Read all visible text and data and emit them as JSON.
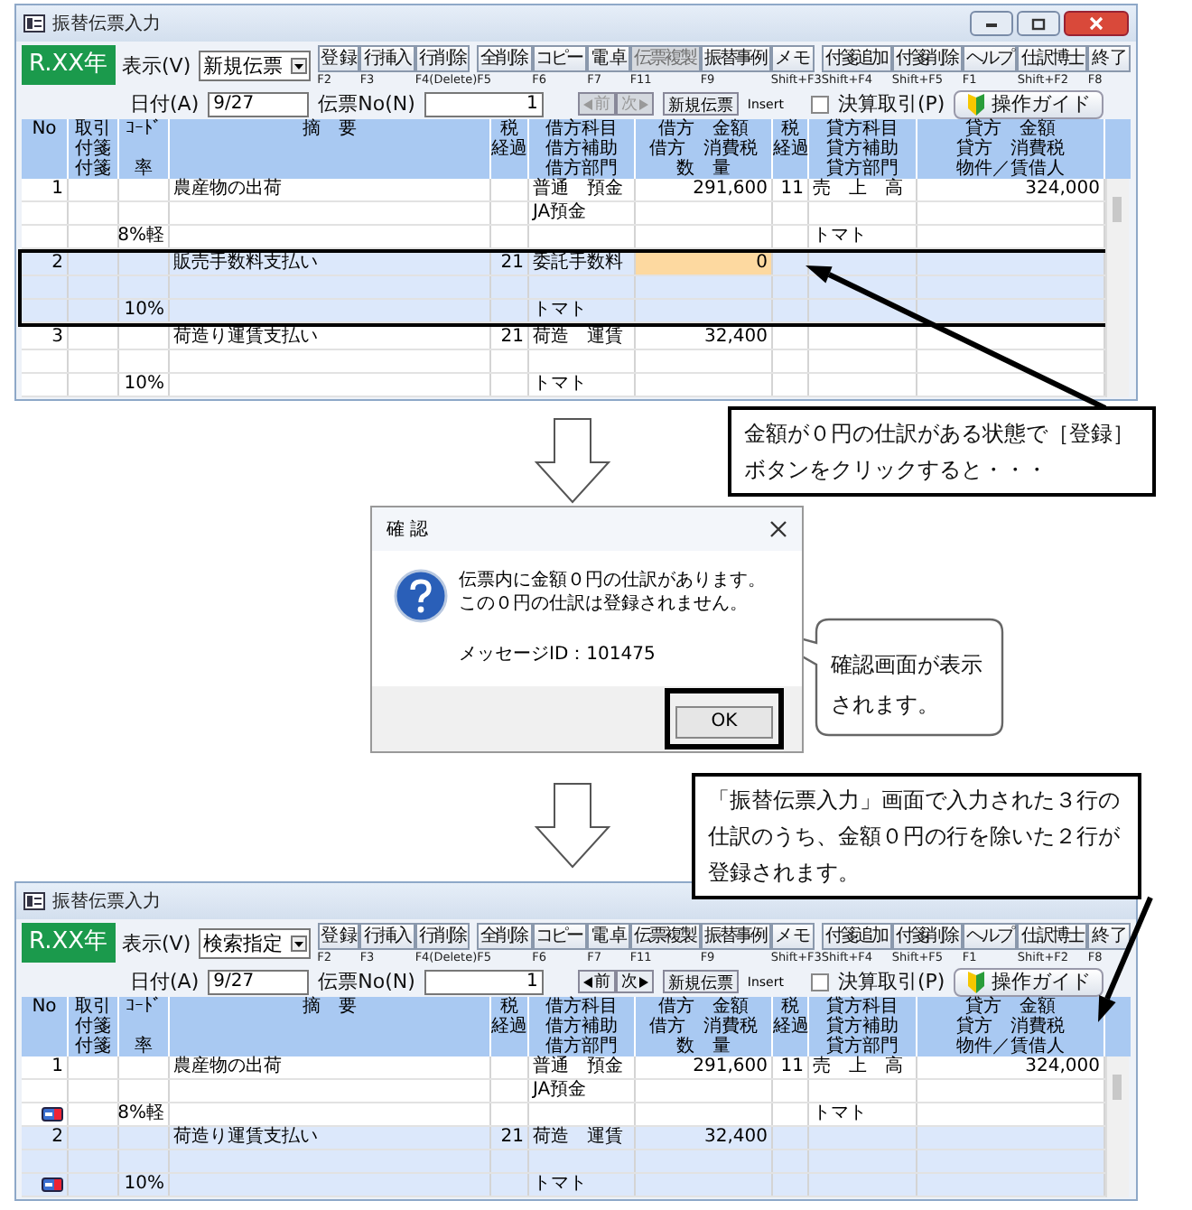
{
  "windows": [
    {
      "title": "振替伝票入力",
      "window_buttons": true,
      "year": "R.XX年",
      "view_label": "表示(V)",
      "view_value": "新規伝票",
      "toolbar": [
        {
          "label": "登 録",
          "key": "F2",
          "disabled": false
        },
        {
          "label": "行挿入",
          "key": "F3",
          "disabled": false
        },
        {
          "label": "行削除",
          "key": "F4(Delete)",
          "disabled": false
        },
        {
          "label": "全削除",
          "key": "F5",
          "disabled": false
        },
        {
          "label": "コピー",
          "key": "F6",
          "disabled": false
        },
        {
          "label": "電 卓",
          "key": "F7",
          "disabled": false
        },
        {
          "label": "伝票複製",
          "key": "F11",
          "disabled": true
        },
        {
          "label": "振替事例",
          "key": "F9",
          "disabled": false
        },
        {
          "label": "メ モ",
          "key": "Shift+F3",
          "disabled": false
        },
        {
          "label": "付箋追加",
          "key": "Shift+F4",
          "disabled": false
        },
        {
          "label": "付箋削除",
          "key": "Shift+F5",
          "disabled": false
        },
        {
          "label": "ヘルプ",
          "key": "F1",
          "disabled": false
        },
        {
          "label": "仕訳博士",
          "key": "Shift+F2",
          "disabled": false
        },
        {
          "label": "終 了",
          "key": "F8",
          "disabled": false
        }
      ],
      "date_label": "日付(A)",
      "date": "9/27",
      "slip_label": "伝票No(N)",
      "slip_no": "1",
      "prev": "前",
      "next": "次",
      "nav_disabled": true,
      "new_slip": "新規伝票",
      "new_slip_key": "Insert",
      "closing": {
        "label": "決算取引(P)",
        "checked": false
      },
      "guide": "操作ガイド",
      "header": [
        {
          "line_1": "No"
        },
        {
          "line_1": "取引",
          "line_2": "付箋",
          "line_3": "付箋"
        },
        {
          "line_1": "ｺｰﾄﾞ",
          "line_3": "率"
        },
        {
          "line_1": "摘　要"
        },
        {
          "line_1": "税",
          "line_2": "経過"
        },
        {
          "line_1": "借方科目",
          "line_2": "借方補助",
          "line_3": "借方部門"
        },
        {
          "line_1": "借方　金額",
          "line_2": "借方　消費税",
          "line_3": "数　量"
        },
        {
          "line_1": "税",
          "line_2": "経過"
        },
        {
          "line_1": "貸方科目",
          "line_2": "貸方補助",
          "line_3": "貸方部門"
        },
        {
          "line_1": "貸方　金額",
          "line_2": "貸方　消費税",
          "line_3": "物件／賃借人"
        }
      ],
      "entries": [
        {
          "selected": false,
          "outlined": false,
          "tag_icon": false,
          "amount_focused": false,
          "line_1": {
            "no": "1",
            "summary": "農産物の出荷",
            "account": "普通　預金",
            "amount": "291,600",
            "credit_tax": "11",
            "credit_account": "売　上　高",
            "credit_amount": "324,000"
          },
          "line_2": {
            "account": "JA預金"
          },
          "line_3": {
            "code": "8%軽",
            "credit_account": "トマト"
          }
        },
        {
          "selected": true,
          "outlined": true,
          "tag_icon": false,
          "amount_focused": true,
          "line_1": {
            "no": "2",
            "summary": "販売手数料支払い",
            "tax": "21",
            "account": "委託手数料",
            "amount": "0"
          },
          "line_3": {
            "code": "10%",
            "account": "トマト"
          }
        },
        {
          "selected": false,
          "outlined": false,
          "tag_icon": false,
          "amount_focused": false,
          "line_1": {
            "no": "3",
            "summary": "荷造り運賃支払い",
            "tax": "21",
            "account": "荷造　運賃",
            "amount": "32,400"
          },
          "line_3": {
            "code": "10%",
            "account": "トマト"
          }
        }
      ]
    },
    {
      "title": "振替伝票入力",
      "window_buttons": false,
      "year": "R.XX年",
      "view_label": "表示(V)",
      "view_value": "検索指定",
      "toolbar": [
        {
          "label": "登 録",
          "key": "F2",
          "disabled": false
        },
        {
          "label": "行挿入",
          "key": "F3",
          "disabled": false
        },
        {
          "label": "行削除",
          "key": "F4(Delete)",
          "disabled": false
        },
        {
          "label": "全削除",
          "key": "F5",
          "disabled": false
        },
        {
          "label": "コピー",
          "key": "F6",
          "disabled": false
        },
        {
          "label": "電 卓",
          "key": "F7",
          "disabled": false
        },
        {
          "label": "伝票複製",
          "key": "F11",
          "disabled": false
        },
        {
          "label": "振替事例",
          "key": "F9",
          "disabled": false
        },
        {
          "label": "メ モ",
          "key": "Shift+F3",
          "disabled": false
        },
        {
          "label": "付箋追加",
          "key": "Shift+F4",
          "disabled": false
        },
        {
          "label": "付箋削除",
          "key": "Shift+F5",
          "disabled": false
        },
        {
          "label": "ヘルプ",
          "key": "F1",
          "disabled": false
        },
        {
          "label": "仕訳博士",
          "key": "Shift+F2",
          "disabled": false
        },
        {
          "label": "終 了",
          "key": "F8",
          "disabled": false
        }
      ],
      "date_label": "日付(A)",
      "date": "9/27",
      "slip_label": "伝票No(N)",
      "slip_no": "1",
      "prev": "前",
      "next": "次",
      "nav_disabled": false,
      "new_slip": "新規伝票",
      "new_slip_key": "Insert",
      "closing": {
        "label": "決算取引(P)",
        "checked": false
      },
      "guide": "操作ガイド",
      "header": [
        {
          "line_1": "No"
        },
        {
          "line_1": "取引",
          "line_2": "付箋",
          "line_3": "付箋"
        },
        {
          "line_1": "ｺｰﾄﾞ",
          "line_3": "率"
        },
        {
          "line_1": "摘　要"
        },
        {
          "line_1": "税",
          "line_2": "経過"
        },
        {
          "line_1": "借方科目",
          "line_2": "借方補助",
          "line_3": "借方部門"
        },
        {
          "line_1": "借方　金額",
          "line_2": "借方　消費税",
          "line_3": "数　量"
        },
        {
          "line_1": "税",
          "line_2": "経過"
        },
        {
          "line_1": "貸方科目",
          "line_2": "貸方補助",
          "line_3": "貸方部門"
        },
        {
          "line_1": "貸方　金額",
          "line_2": "貸方　消費税",
          "line_3": "物件／賃借人"
        }
      ],
      "entries": [
        {
          "selected": false,
          "outlined": false,
          "tag_icon": true,
          "amount_focused": false,
          "line_1": {
            "no": "1",
            "summary": "農産物の出荷",
            "account": "普通　預金",
            "amount": "291,600",
            "credit_tax": "11",
            "credit_account": "売　上　高",
            "credit_amount": "324,000"
          },
          "line_2": {
            "account": "JA預金"
          },
          "line_3": {
            "code": "8%軽",
            "credit_account": "トマト"
          }
        },
        {
          "selected": true,
          "outlined": false,
          "tag_icon": true,
          "amount_focused": false,
          "line_1": {
            "no": "2",
            "summary": "荷造り運賃支払い",
            "tax": "21",
            "account": "荷造　運賃",
            "amount": "32,400"
          },
          "line_3": {
            "code": "10%",
            "account": "トマト"
          }
        }
      ]
    }
  ],
  "callouts": [
    {
      "kind": "box",
      "text": "金額が０円の仕訳がある状態で［登録］ボタンをクリックすると・・・"
    },
    {
      "kind": "bubble",
      "text": "確認画面が表示されます。"
    },
    {
      "kind": "box",
      "text": "「振替伝票入力」画面で入力された３行の仕訳のうち、金額０円の行を除いた２行が登録されます。"
    }
  ],
  "dialog": {
    "title": "確 認",
    "message_lines": [
      "伝票内に金額０円の仕訳があります。",
      "この０円の仕訳は登録されません。"
    ],
    "message_id": "メッセージID：101475",
    "ok": "OK",
    "ok_highlighted": true
  }
}
